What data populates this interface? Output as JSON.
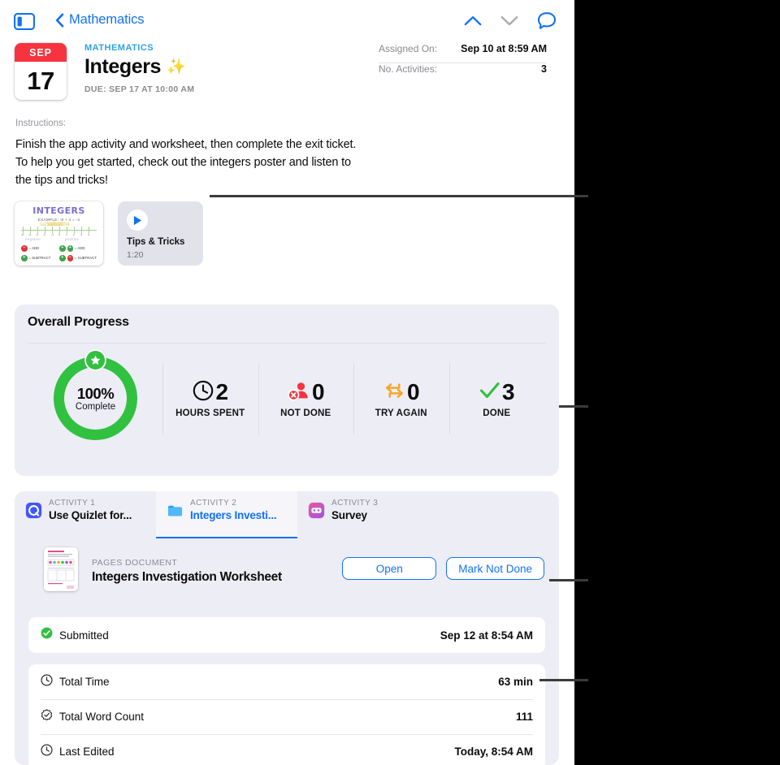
{
  "navbar": {
    "sidebar_toggle_icon": "sidebar-toggle-icon",
    "back_label": "Mathematics",
    "back_icon": "chevron-left-icon",
    "up_icon": "chevron-up-icon",
    "down_icon": "chevron-down-icon",
    "comment_icon": "comment-bubble-icon"
  },
  "assignment": {
    "date_month": "SEP",
    "date_day": "17",
    "course": "MATHEMATICS",
    "title": "Integers",
    "title_emoji": "✨",
    "due": "DUE: SEP 17 AT 10:00 AM"
  },
  "meta": {
    "rows": [
      {
        "key": "Assigned On:",
        "value": "Sep 10 at 8:59 AM"
      },
      {
        "key": "No. Activities:",
        "value": "3"
      }
    ]
  },
  "instructions": {
    "label": "Instructions:",
    "text": "Finish the app activity and worksheet, then complete the exit ticket. To help you get started, check out the integers poster and listen to the tips and tricks!"
  },
  "attachments": {
    "poster": {
      "name": "poster-attachment",
      "title": "INTEGERS",
      "example": "EXAMPLE: -8 + 4 = -4",
      "negative_label": "negative",
      "positive_label": "positive",
      "ticks": [
        "-5",
        "-4",
        "-3",
        "-2",
        "-1",
        "0",
        "1",
        "2",
        "3",
        "4",
        "5"
      ],
      "rules": [
        {
          "a": "−",
          "a_color": "red",
          "text": "= ADD"
        },
        {
          "a": "+",
          "a_color": "green",
          "text": "= SUBTRACT"
        },
        {
          "b1": "+",
          "b2": "+",
          "text": "= ADD"
        },
        {
          "b1": "+",
          "b2": "−",
          "text": "= SUBTRACT"
        }
      ]
    },
    "tips": {
      "name": "tips-and-tricks-audio",
      "title": "Tips & Tricks",
      "duration": "1:20",
      "play_icon": "play-icon"
    }
  },
  "progress": {
    "heading": "Overall Progress",
    "ring": {
      "percent": "100%",
      "sublabel": "Complete",
      "badge_icon": "star-badge-icon",
      "color": "#31C140"
    },
    "stats": [
      {
        "icon": "clock-icon",
        "value": "2",
        "label": "HOURS SPENT",
        "color": "#0B0B0C"
      },
      {
        "icon": "person-x-icon",
        "value": "0",
        "label": "NOT DONE",
        "color": "#F6333F"
      },
      {
        "icon": "loop-arrows-icon",
        "value": "0",
        "label": "TRY AGAIN",
        "color": "#F5A623"
      },
      {
        "icon": "checkmark-icon",
        "value": "3",
        "label": "DONE",
        "color": "#31C140"
      }
    ]
  },
  "activities": {
    "tabs": [
      {
        "index": "ACTIVITY 1",
        "name": "Use Quizlet for...",
        "icon": "quizlet-app-icon",
        "selected": false
      },
      {
        "index": "ACTIVITY 2",
        "name": "Integers Investi...",
        "icon": "folder-icon",
        "selected": true
      },
      {
        "index": "ACTIVITY 3",
        "name": "Survey",
        "icon": "survey-app-icon",
        "selected": false
      }
    ],
    "document": {
      "kind": "PAGES DOCUMENT",
      "name": "Integers Investigation Worksheet",
      "thumbnail_icon": "document-thumbnail",
      "open_button": "Open",
      "mark_button": "Mark Not Done"
    },
    "submitted": {
      "icon": "check-circle-icon",
      "label": "Submitted",
      "value": "Sep 12 at 8:54 AM"
    },
    "info_rows": [
      {
        "icon": "clock-icon",
        "label": "Total Time",
        "value": "63 min"
      },
      {
        "icon": "badge-check-icon",
        "label": "Total Word Count",
        "value": "111"
      },
      {
        "icon": "clock-icon",
        "label": "Last Edited",
        "value": "Today, 8:54 AM"
      }
    ]
  },
  "colors": {
    "accent_blue": "#1272F3",
    "green": "#31C140",
    "red": "#F6333F",
    "orange": "#F5A623",
    "card_bg": "#EDEDF5"
  }
}
